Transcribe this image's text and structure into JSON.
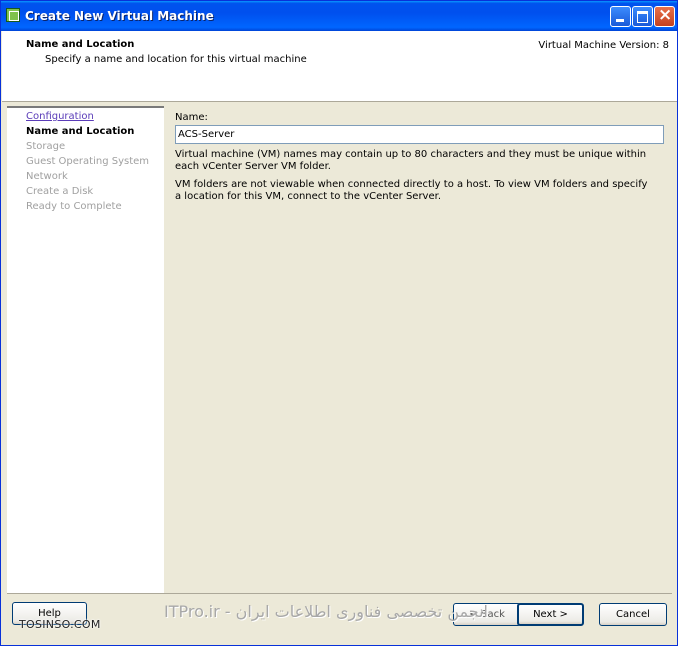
{
  "window": {
    "title": "Create New Virtual Machine"
  },
  "header": {
    "title": "Name and Location",
    "subtitle": "Specify a name and location for this virtual machine",
    "version": "Virtual Machine Version: 8"
  },
  "nav": {
    "items": [
      {
        "label": "Configuration",
        "state": "link"
      },
      {
        "label": "Name and Location",
        "state": "active"
      },
      {
        "label": "Storage",
        "state": "disabled"
      },
      {
        "label": "Guest Operating System",
        "state": "disabled"
      },
      {
        "label": "Network",
        "state": "disabled"
      },
      {
        "label": "Create a Disk",
        "state": "disabled"
      },
      {
        "label": "Ready to Complete",
        "state": "disabled"
      }
    ]
  },
  "form": {
    "name_label": "Name:",
    "name_value": "ACS-Server",
    "help1": "Virtual machine (VM) names may contain up to 80 characters and they must be unique within each vCenter Server VM folder.",
    "help2": "VM folders are not viewable when connected directly to a host. To view VM folders and specify a location for this VM, connect to the vCenter Server."
  },
  "buttons": {
    "help": "Help",
    "back": "< Back",
    "next": "Next >",
    "cancel": "Cancel"
  },
  "watermark": {
    "site": "TOSINSO.COM",
    "center": "ITPro.ir - انجمن تخصصی فناوری اطلاعات ایران"
  }
}
